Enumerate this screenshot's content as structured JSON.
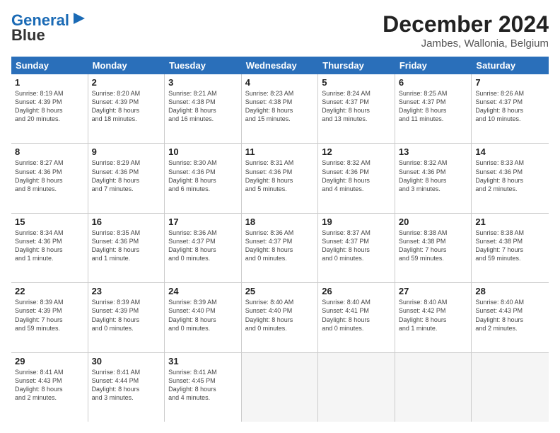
{
  "logo": {
    "line1": "General",
    "line2": "Blue"
  },
  "title": "December 2024",
  "subtitle": "Jambes, Wallonia, Belgium",
  "days": [
    "Sunday",
    "Monday",
    "Tuesday",
    "Wednesday",
    "Thursday",
    "Friday",
    "Saturday"
  ],
  "weeks": [
    [
      {
        "day": "1",
        "info": "Sunrise: 8:19 AM\nSunset: 4:39 PM\nDaylight: 8 hours\nand 20 minutes."
      },
      {
        "day": "2",
        "info": "Sunrise: 8:20 AM\nSunset: 4:39 PM\nDaylight: 8 hours\nand 18 minutes."
      },
      {
        "day": "3",
        "info": "Sunrise: 8:21 AM\nSunset: 4:38 PM\nDaylight: 8 hours\nand 16 minutes."
      },
      {
        "day": "4",
        "info": "Sunrise: 8:23 AM\nSunset: 4:38 PM\nDaylight: 8 hours\nand 15 minutes."
      },
      {
        "day": "5",
        "info": "Sunrise: 8:24 AM\nSunset: 4:37 PM\nDaylight: 8 hours\nand 13 minutes."
      },
      {
        "day": "6",
        "info": "Sunrise: 8:25 AM\nSunset: 4:37 PM\nDaylight: 8 hours\nand 11 minutes."
      },
      {
        "day": "7",
        "info": "Sunrise: 8:26 AM\nSunset: 4:37 PM\nDaylight: 8 hours\nand 10 minutes."
      }
    ],
    [
      {
        "day": "8",
        "info": "Sunrise: 8:27 AM\nSunset: 4:36 PM\nDaylight: 8 hours\nand 8 minutes."
      },
      {
        "day": "9",
        "info": "Sunrise: 8:29 AM\nSunset: 4:36 PM\nDaylight: 8 hours\nand 7 minutes."
      },
      {
        "day": "10",
        "info": "Sunrise: 8:30 AM\nSunset: 4:36 PM\nDaylight: 8 hours\nand 6 minutes."
      },
      {
        "day": "11",
        "info": "Sunrise: 8:31 AM\nSunset: 4:36 PM\nDaylight: 8 hours\nand 5 minutes."
      },
      {
        "day": "12",
        "info": "Sunrise: 8:32 AM\nSunset: 4:36 PM\nDaylight: 8 hours\nand 4 minutes."
      },
      {
        "day": "13",
        "info": "Sunrise: 8:32 AM\nSunset: 4:36 PM\nDaylight: 8 hours\nand 3 minutes."
      },
      {
        "day": "14",
        "info": "Sunrise: 8:33 AM\nSunset: 4:36 PM\nDaylight: 8 hours\nand 2 minutes."
      }
    ],
    [
      {
        "day": "15",
        "info": "Sunrise: 8:34 AM\nSunset: 4:36 PM\nDaylight: 8 hours\nand 1 minute."
      },
      {
        "day": "16",
        "info": "Sunrise: 8:35 AM\nSunset: 4:36 PM\nDaylight: 8 hours\nand 1 minute."
      },
      {
        "day": "17",
        "info": "Sunrise: 8:36 AM\nSunset: 4:37 PM\nDaylight: 8 hours\nand 0 minutes."
      },
      {
        "day": "18",
        "info": "Sunrise: 8:36 AM\nSunset: 4:37 PM\nDaylight: 8 hours\nand 0 minutes."
      },
      {
        "day": "19",
        "info": "Sunrise: 8:37 AM\nSunset: 4:37 PM\nDaylight: 8 hours\nand 0 minutes."
      },
      {
        "day": "20",
        "info": "Sunrise: 8:38 AM\nSunset: 4:38 PM\nDaylight: 7 hours\nand 59 minutes."
      },
      {
        "day": "21",
        "info": "Sunrise: 8:38 AM\nSunset: 4:38 PM\nDaylight: 7 hours\nand 59 minutes."
      }
    ],
    [
      {
        "day": "22",
        "info": "Sunrise: 8:39 AM\nSunset: 4:39 PM\nDaylight: 7 hours\nand 59 minutes."
      },
      {
        "day": "23",
        "info": "Sunrise: 8:39 AM\nSunset: 4:39 PM\nDaylight: 8 hours\nand 0 minutes."
      },
      {
        "day": "24",
        "info": "Sunrise: 8:39 AM\nSunset: 4:40 PM\nDaylight: 8 hours\nand 0 minutes."
      },
      {
        "day": "25",
        "info": "Sunrise: 8:40 AM\nSunset: 4:40 PM\nDaylight: 8 hours\nand 0 minutes."
      },
      {
        "day": "26",
        "info": "Sunrise: 8:40 AM\nSunset: 4:41 PM\nDaylight: 8 hours\nand 0 minutes."
      },
      {
        "day": "27",
        "info": "Sunrise: 8:40 AM\nSunset: 4:42 PM\nDaylight: 8 hours\nand 1 minute."
      },
      {
        "day": "28",
        "info": "Sunrise: 8:40 AM\nSunset: 4:43 PM\nDaylight: 8 hours\nand 2 minutes."
      }
    ],
    [
      {
        "day": "29",
        "info": "Sunrise: 8:41 AM\nSunset: 4:43 PM\nDaylight: 8 hours\nand 2 minutes."
      },
      {
        "day": "30",
        "info": "Sunrise: 8:41 AM\nSunset: 4:44 PM\nDaylight: 8 hours\nand 3 minutes."
      },
      {
        "day": "31",
        "info": "Sunrise: 8:41 AM\nSunset: 4:45 PM\nDaylight: 8 hours\nand 4 minutes."
      },
      {
        "day": "",
        "info": ""
      },
      {
        "day": "",
        "info": ""
      },
      {
        "day": "",
        "info": ""
      },
      {
        "day": "",
        "info": ""
      }
    ]
  ]
}
